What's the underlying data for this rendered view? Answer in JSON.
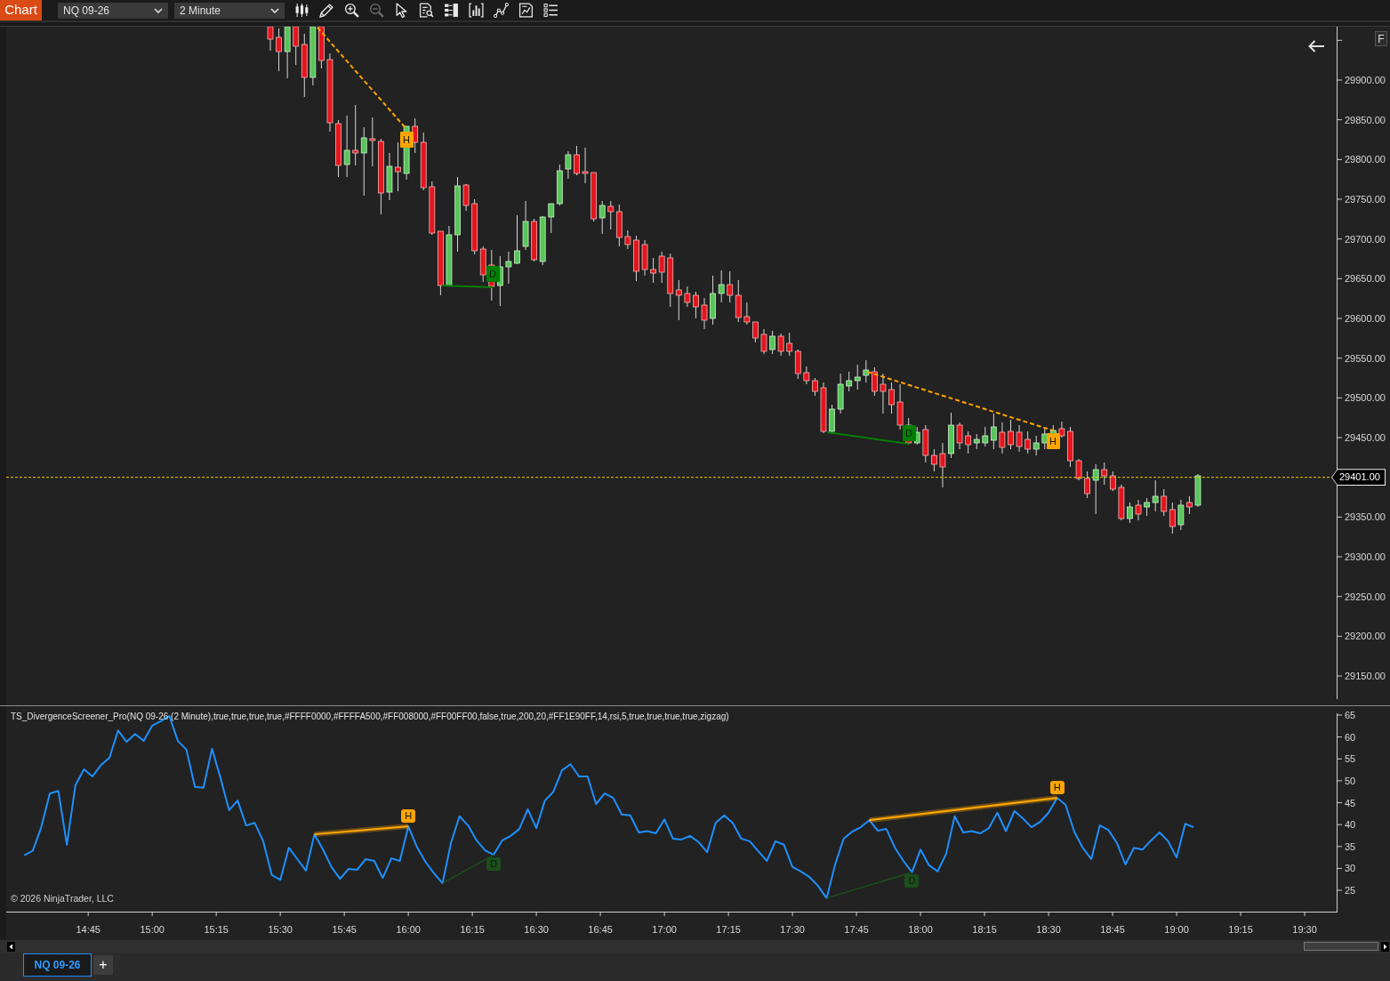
{
  "toolbar": {
    "title": "Chart",
    "instrument": "NQ 09-26",
    "interval": "2 Minute"
  },
  "price_panel": {
    "signals": [
      {
        "label": "H",
        "color": "#ffa500",
        "dashed": true
      },
      {
        "label": "D",
        "color": "#008000",
        "dashed": false
      },
      {
        "label": "D",
        "color": "#008000",
        "dashed": false
      },
      {
        "label": "H",
        "color": "#ffa500",
        "dashed": true
      }
    ],
    "corner_button": "F",
    "price_axis": {
      "upper_labels": [
        "29900.00",
        "29850.00",
        "29800.00",
        "29750.00",
        "29700.00",
        "29650.00",
        "29600.00",
        "29550.00",
        "29500.00",
        "29450.00"
      ],
      "last_price": "29401.00",
      "lower_labels": [
        "29350.00",
        "29300.00",
        "29250.00",
        "29200.00",
        "29150.00"
      ]
    }
  },
  "indicator_panel": {
    "title": "TS_DivergenceScreener_Pro(NQ 09-26 (2 Minute),true,true,true,true,#FFFF0000,#FFFFA500,#FF008000,#FF00FF00,false,true,200,20,#FF1E90FF,14,rsi,5,true,true,true,true,zigzag)",
    "signals": [
      {
        "label": "H",
        "color": "#ffa500"
      },
      {
        "label": "D",
        "color": "#1b4f1b"
      },
      {
        "label": "D",
        "color": "#1b4f1b"
      },
      {
        "label": "H",
        "color": "#ffa500"
      }
    ],
    "chart_data": {
      "type": "line",
      "ylim": [
        20.13,
        65.41
      ],
      "yticks": [
        {
          "value": 65,
          "label": "65"
        },
        {
          "value": 60,
          "label": "60"
        },
        {
          "value": 55,
          "label": "55"
        },
        {
          "value": 50,
          "label": "50"
        },
        {
          "value": 45,
          "label": "45"
        },
        {
          "value": 40,
          "label": "40"
        },
        {
          "value": 35,
          "label": "35"
        },
        {
          "value": 30,
          "label": "30"
        },
        {
          "value": 25,
          "label": "25"
        }
      ],
      "series": [
        {
          "color": "#1e90ff",
          "values": [
            33,
            34,
            39.4,
            47.1,
            47.7,
            35.4,
            49,
            52.6,
            51,
            53.6,
            55.3,
            61.5,
            58.9,
            60.7,
            59.1,
            62.6,
            63.6,
            64.8,
            59.1,
            57.1,
            48.6,
            48.4,
            57.3,
            50.6,
            43.3,
            45.5,
            39.8,
            40.4,
            36.2,
            28.5,
            27.4,
            34.7,
            32.1,
            29.5,
            37.8,
            34.3,
            30.3,
            27.6,
            29.9,
            29.7,
            32.1,
            31.7,
            27.8,
            32.3,
            31.7,
            39.6,
            34.9,
            31.5,
            28.9,
            26.6,
            35.8,
            41.9,
            39.8,
            36.4,
            34.1,
            33.1,
            36.4,
            37.4,
            39,
            43.5,
            39.2,
            45.5,
            47.5,
            52.4,
            53.8,
            51,
            51,
            44.7,
            47.1,
            46.1,
            42.3,
            42.1,
            38.2,
            38.5,
            38,
            41.2,
            36.8,
            36.6,
            37.4,
            36,
            33.7,
            40.4,
            42.1,
            40.4,
            36.8,
            36.2,
            33.9,
            31.7,
            36.2,
            35.4,
            30.3,
            29.3,
            28,
            26,
            23.2,
            30.9,
            36.8,
            38.4,
            39.4,
            41,
            38.6,
            39,
            34.7,
            31.7,
            29.1,
            34.3,
            30.7,
            29.3,
            33.3,
            41.9,
            38.2,
            38.5,
            38,
            39.2,
            42.7,
            38.5,
            43.1,
            41.4,
            39.4,
            40.6,
            42.7,
            46.1,
            44.5,
            38.4,
            34.7,
            32.1,
            39.8,
            38.8,
            35.8,
            30.9,
            34.7,
            34.3,
            36.4,
            38.2,
            36.2,
            32.5,
            40.2,
            39.4
          ]
        }
      ]
    },
    "copyright": "© 2026 NinjaTrader, LLC",
    "time_labels": [
      "14:45",
      "15:00",
      "15:15",
      "15:30",
      "15:45",
      "16:00",
      "16:15",
      "16:30",
      "16:45",
      "17:00",
      "17:15",
      "17:30",
      "17:45",
      "18:00",
      "18:15",
      "18:30",
      "18:45",
      "19:00",
      "19:15",
      "19:30"
    ]
  },
  "tabs": [
    {
      "label": "NQ 09-26",
      "selected": true
    }
  ],
  "new_tab": "+"
}
